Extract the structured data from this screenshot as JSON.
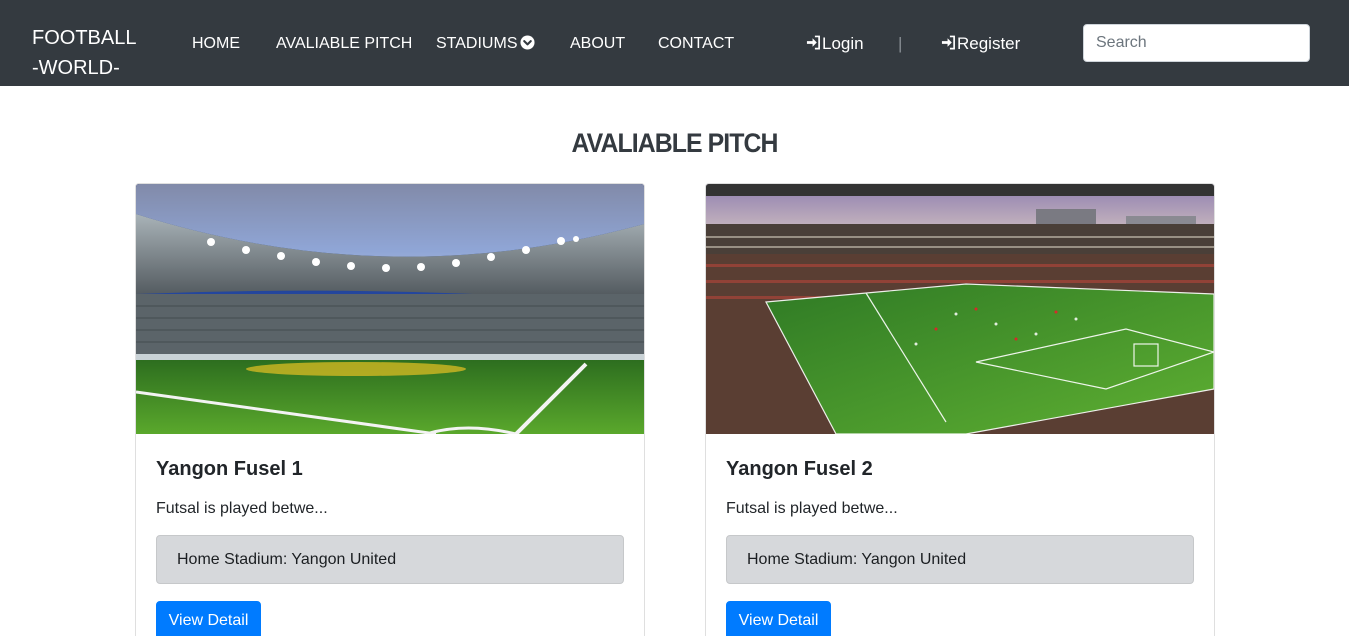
{
  "navbar": {
    "brand_line1": "FOOTBALL",
    "brand_line2": "-WORLD-",
    "links": {
      "home": "HOME",
      "pitch": "AVALIABLE PITCH",
      "stadiums": "STADIUMS",
      "about": "ABOUT",
      "contact": "CONTACT"
    },
    "login": "Login",
    "divider": "|",
    "register": "Register",
    "search_placeholder": "Search"
  },
  "main": {
    "title": "AVALIABLE PITCH",
    "cards": [
      {
        "title": "Yangon Fusel 1",
        "text": "Futsal is played betwe...",
        "stadium": "Home Stadium: Yangon United",
        "button": "View Detail",
        "image_icon": "stadium-photo"
      },
      {
        "title": "Yangon Fusel 2",
        "text": "Futsal is played betwe...",
        "stadium": "Home Stadium: Yangon United",
        "button": "View Detail",
        "image_icon": "stadium-photo"
      }
    ]
  },
  "colors": {
    "navbar_bg": "#343a40",
    "primary": "#007bff",
    "stadium_box_bg": "#d6d8db"
  }
}
